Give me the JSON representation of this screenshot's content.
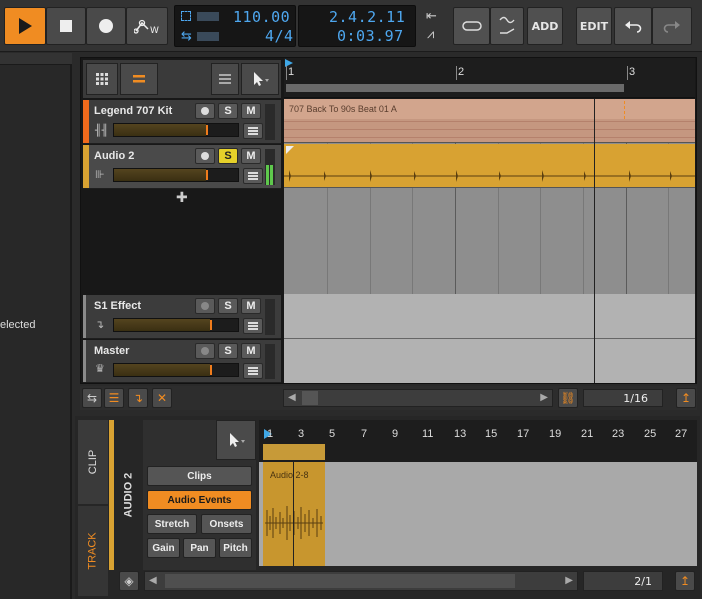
{
  "transport": {
    "tempo": "110.00",
    "time_signature": "4/4",
    "position_bars": "2.4.2.11",
    "position_time": "0:03.97",
    "add_label": "ADD",
    "edit_label": "EDIT",
    "icons": [
      "play-icon",
      "stop-icon",
      "record-icon",
      "automation-write-icon",
      "loop-icon",
      "punch-icon",
      "metronome-icon",
      "tap-icon",
      "undo-icon",
      "redo-icon"
    ]
  },
  "left_panel": {
    "partial_text": "elected"
  },
  "arranger": {
    "tracks": [
      {
        "name": "Legend 707 Kit",
        "color": "#f06a1c",
        "solo": "S",
        "mute": "M",
        "armed": false,
        "solo_on": false,
        "clip_name": "707 Back To 90s Beat 01 A"
      },
      {
        "name": "Audio 2",
        "color": "#d8a232",
        "solo": "S",
        "mute": "M",
        "armed": false,
        "solo_on": true,
        "clip_name": ""
      },
      {
        "name": "S1 Effect",
        "color": "#8a8a8a",
        "solo": "S",
        "mute": "M",
        "armed": false,
        "solo_on": false
      },
      {
        "name": "Master",
        "color": "#8a8a8a",
        "solo": "S",
        "mute": "M",
        "armed": false,
        "solo_on": false
      }
    ],
    "ruler_bars": [
      "1",
      "2",
      "3"
    ],
    "grid": "1/16"
  },
  "editor": {
    "tab_clip": "CLIP",
    "tab_track": "TRACK",
    "track_name": "AUDIO 2",
    "buttons": {
      "clips": "Clips",
      "audio_events": "Audio Events",
      "stretch": "Stretch",
      "onsets": "Onsets",
      "gain": "Gain",
      "pan": "Pan",
      "pitch": "Pitch"
    },
    "ruler_bars": [
      "1",
      "3",
      "5",
      "7",
      "9",
      "11",
      "13",
      "15",
      "17",
      "19",
      "21",
      "23",
      "25",
      "27"
    ],
    "clip_name": "Audio 2-8",
    "zoom": "2/1"
  },
  "colors": {
    "accent": "#f08c22",
    "lcd_text": "#4ea7ef",
    "audio_clip": "#d8a232"
  }
}
